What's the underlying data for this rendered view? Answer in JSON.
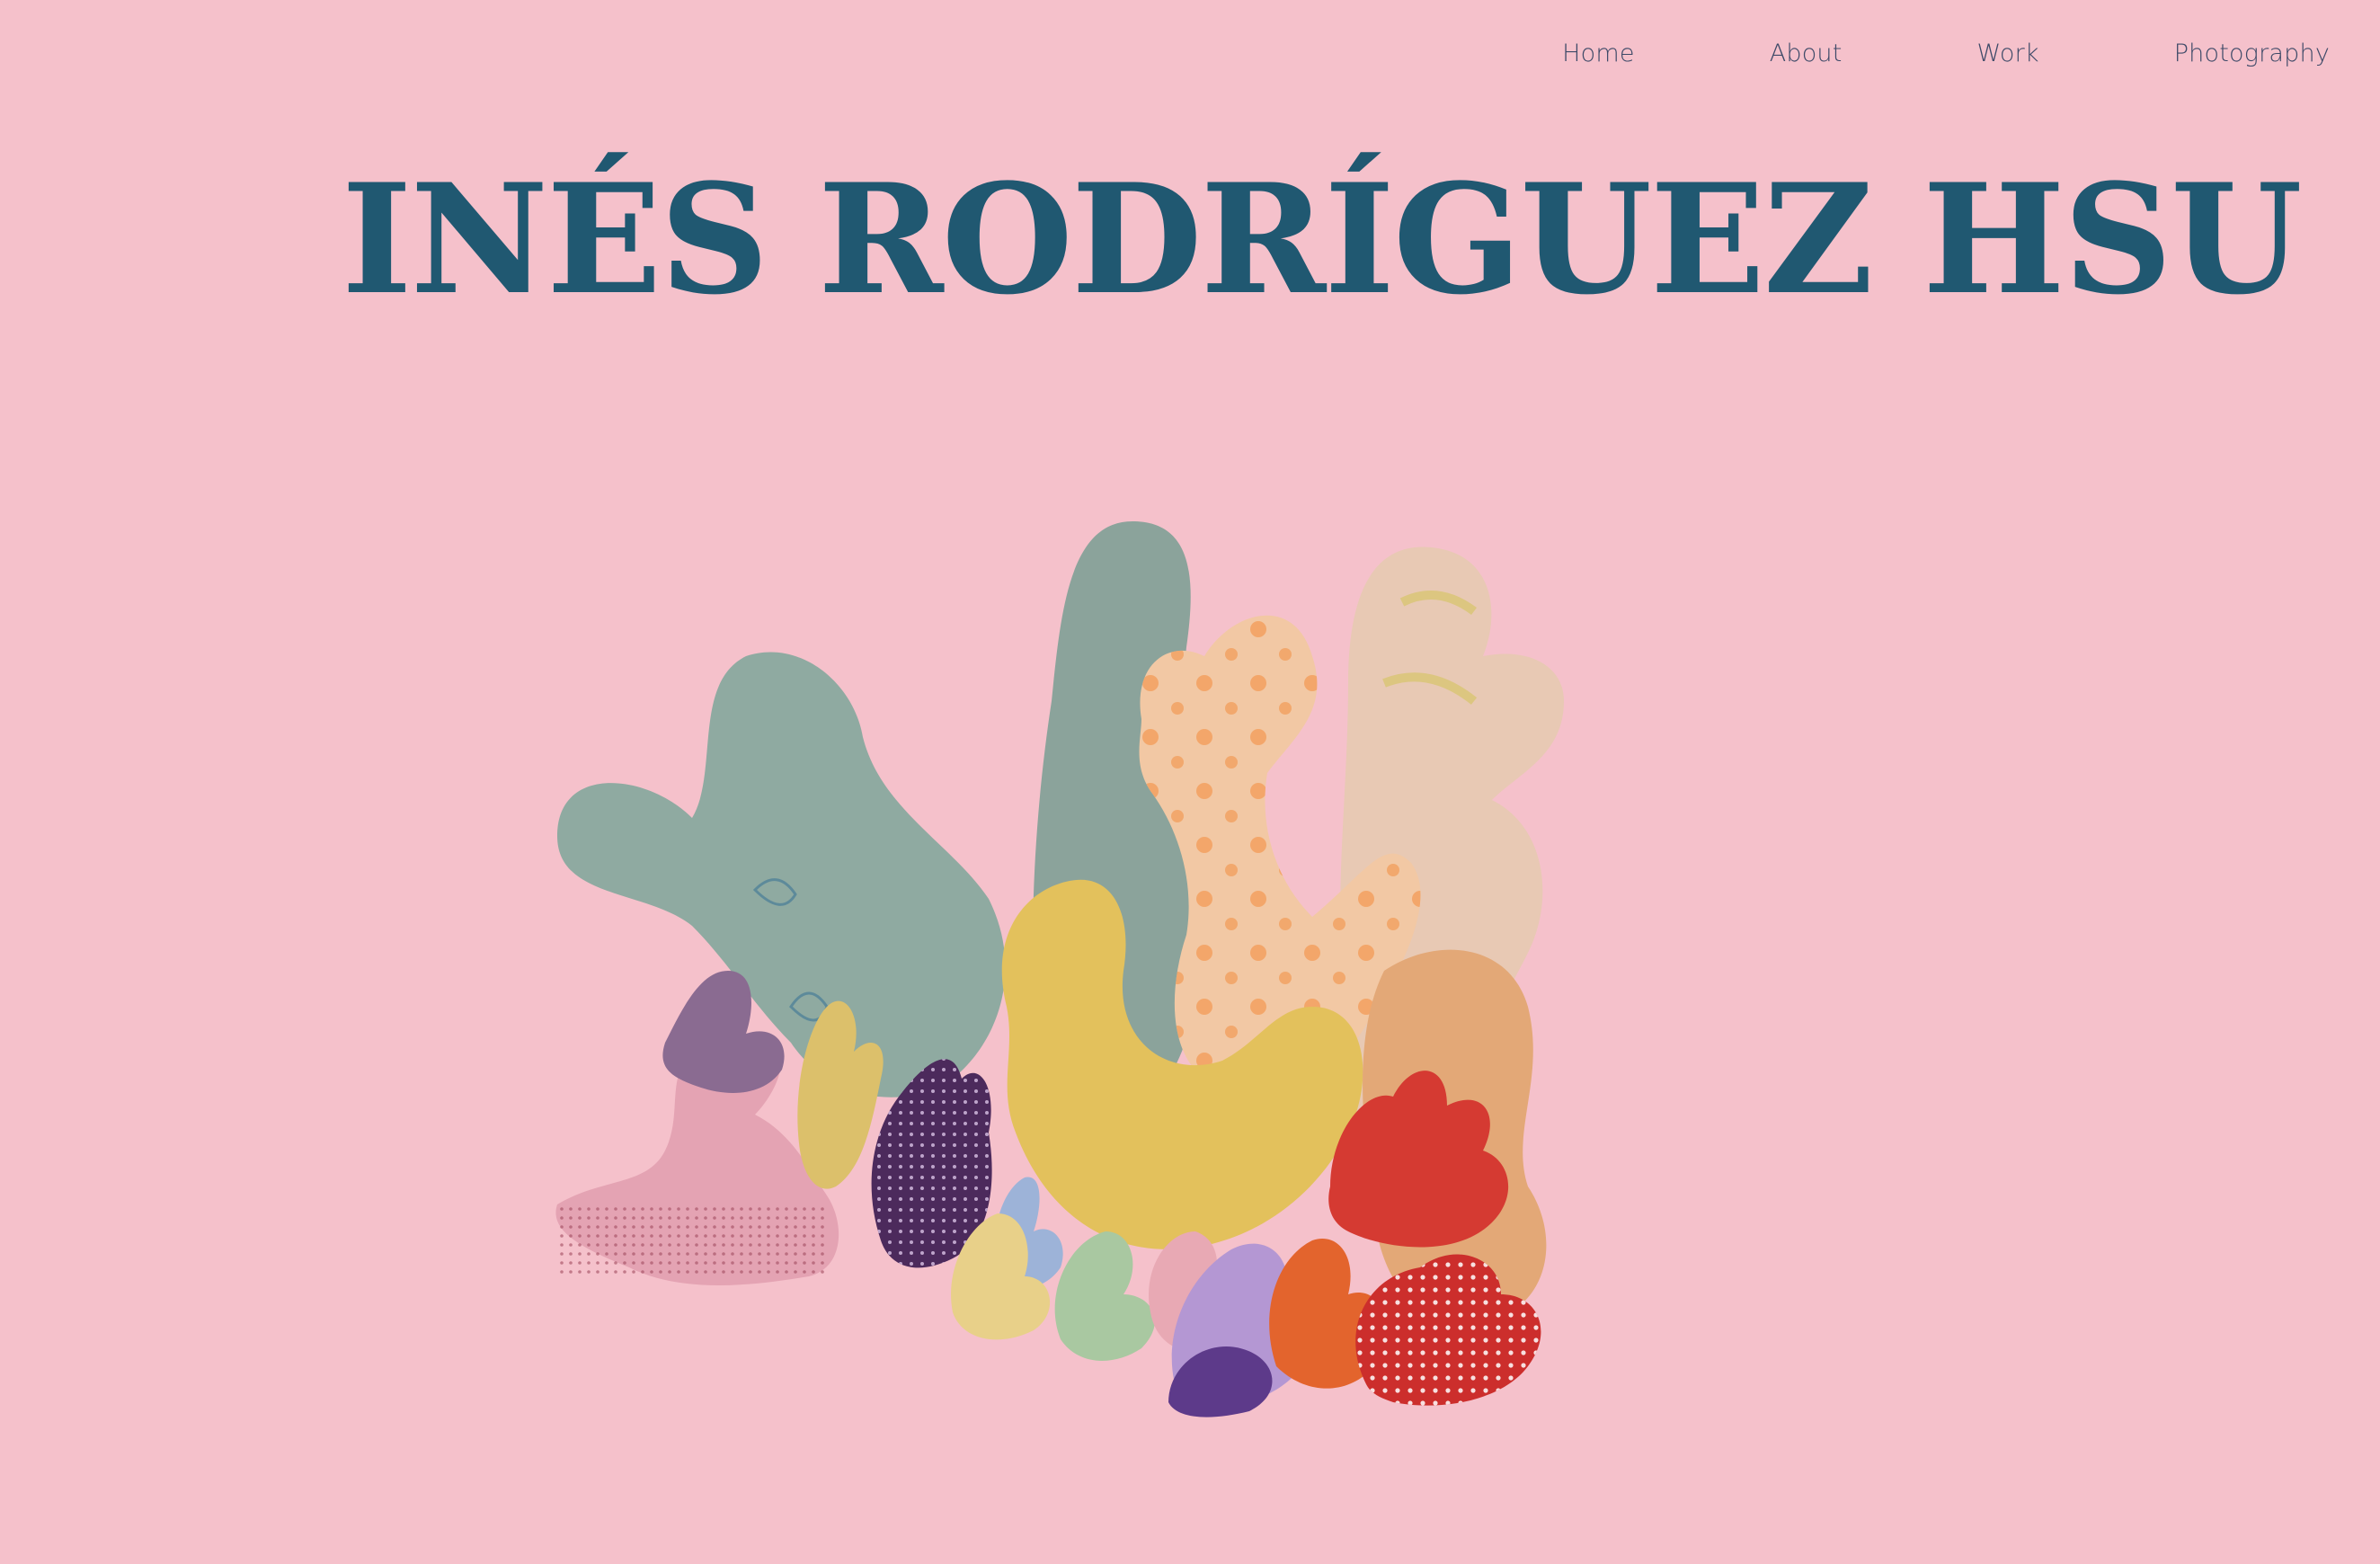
{
  "nav": {
    "items": [
      {
        "label": "Home"
      },
      {
        "label": "About"
      },
      {
        "label": "Work"
      },
      {
        "label": "Photography"
      }
    ]
  },
  "header": {
    "title": "INÉS RODRÍGUEZ HSU"
  },
  "colors": {
    "background": "#f5c1cb",
    "title": "#205871",
    "nav_text": "#3e4a68"
  },
  "hero": {
    "subject": "soft-sculpture-coral-reef"
  }
}
